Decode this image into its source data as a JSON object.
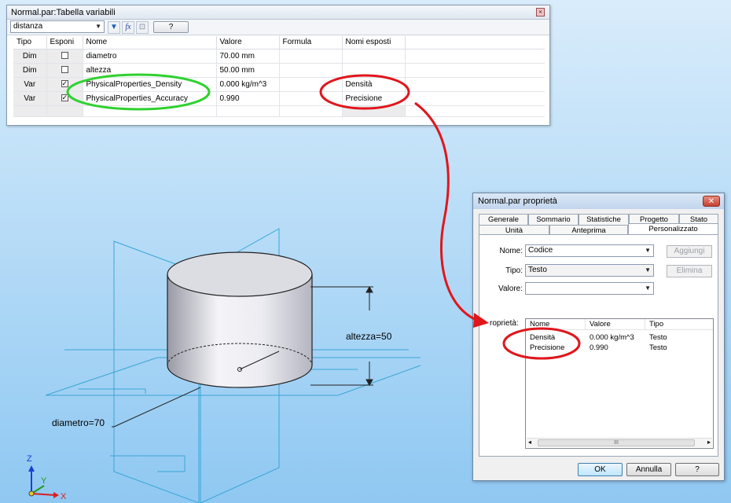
{
  "var_window": {
    "title": "Normal.par:Tabella variabili",
    "filter_value": "distanza",
    "help_button": "?",
    "columns": [
      "Tipo",
      "Esponi",
      "Nome",
      "Valore",
      "Formula",
      "Nomi esposti"
    ],
    "rows": [
      {
        "tipo": "Dim",
        "esponi": false,
        "nome": "diametro",
        "valore": "70.00 mm",
        "formula": "",
        "nome_esposto": ""
      },
      {
        "tipo": "Dim",
        "esponi": false,
        "nome": "altezza",
        "valore": "50.00 mm",
        "formula": "",
        "nome_esposto": ""
      },
      {
        "tipo": "Var",
        "esponi": true,
        "nome": "PhysicalProperties_Density",
        "valore": "0.000 kg/m^3",
        "formula": "",
        "nome_esposto": "Densità"
      },
      {
        "tipo": "Var",
        "esponi": true,
        "nome": "PhysicalProperties_Accuracy",
        "valore": "0.990",
        "formula": "",
        "nome_esposto": "Precisione"
      }
    ]
  },
  "model_view": {
    "altezza_label": "altezza=50",
    "diametro_label": "diametro=70",
    "axes": {
      "z": "Z",
      "y": "Y",
      "x": "X"
    }
  },
  "prop_dialog": {
    "title": "Normal.par proprietà",
    "tabs_row1": [
      "Generale",
      "Sommario",
      "Statistiche",
      "Progetto",
      "Stato"
    ],
    "tabs_row2": [
      "Unità",
      "Anteprima",
      "Personalizzato"
    ],
    "nome_label": "Nome:",
    "nome_value": "Codice",
    "tipo_label": "Tipo:",
    "tipo_value": "Testo",
    "valore_label": "Valore:",
    "valore_value": "",
    "aggiungi": "Aggiungi",
    "elimina": "Elimina",
    "proprieta_label": "roprietà:",
    "list_columns": [
      "Nome",
      "Valore",
      "Tipo"
    ],
    "list_rows": [
      {
        "nome": "Densità",
        "valore": "0.000 kg/m^3",
        "tipo": "Testo"
      },
      {
        "nome": "Precisione",
        "valore": "0.990",
        "tipo": "Testo"
      }
    ],
    "scroll_grip": "III",
    "ok": "OK",
    "annulla": "Annulla",
    "help": "?"
  },
  "colors": {
    "green_highlight": "#2fd12f",
    "red_highlight": "#e0161b",
    "wireframe_blue": "#3aa6d8"
  }
}
